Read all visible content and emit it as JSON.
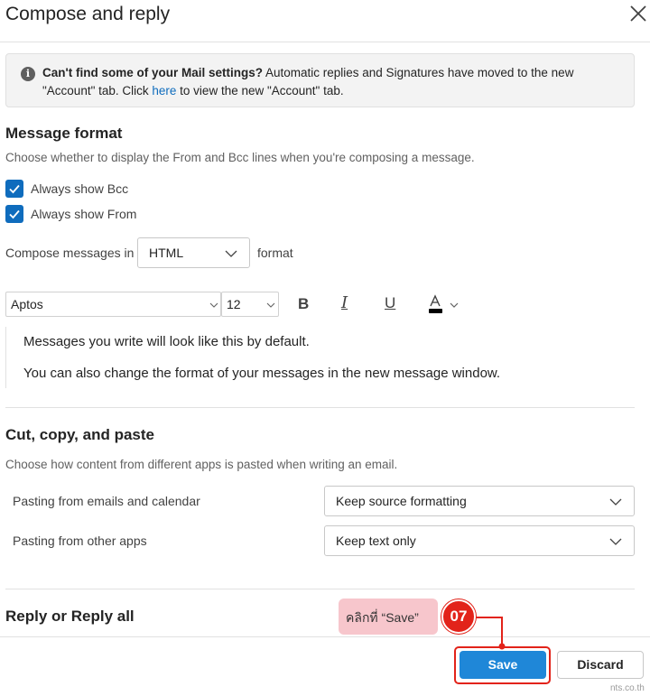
{
  "dialog": {
    "title": "Compose and reply"
  },
  "banner": {
    "bold": "Can't find some of your Mail settings?",
    "text_before_link": " Automatic replies and Signatures have moved to the new \"Account\" tab. Click ",
    "link": "here",
    "text_after_link": " to view the new \"Account\" tab."
  },
  "message_format": {
    "heading": "Message format",
    "description": "Choose whether to display the From and Bcc lines when you're composing a message.",
    "bcc_label": "Always show Bcc",
    "bcc_checked": true,
    "from_label": "Always show From",
    "from_checked": true,
    "compose_prefix": "Compose messages in",
    "compose_format": "HTML",
    "compose_suffix": "format"
  },
  "toolbar": {
    "font": "Aptos",
    "size": "12",
    "bold_icon": "B",
    "italic_icon": "I",
    "underline_icon": "U",
    "font_color": "#000000"
  },
  "preview": {
    "line1": "Messages you write will look like this by default.",
    "line2": "You can also change the format of your messages in the new message window."
  },
  "cut_copy_paste": {
    "heading": "Cut, copy, and paste",
    "description": "Choose how content from different apps is pasted when writing an email.",
    "row1_label": "Pasting from emails and calendar",
    "row1_value": "Keep source formatting",
    "row2_label": "Pasting from other apps",
    "row2_value": "Keep text only"
  },
  "reply": {
    "heading": "Reply or Reply all"
  },
  "annotation": {
    "callout": "คลิกที่ “Save”",
    "step": "07"
  },
  "footer": {
    "save": "Save",
    "discard": "Discard",
    "watermark": "nts.co.th"
  },
  "colors": {
    "accent": "#0f6cbd",
    "save_button": "#1f87d8",
    "annotation_red": "#e2231a",
    "callout_pink": "#f7c6cc"
  }
}
